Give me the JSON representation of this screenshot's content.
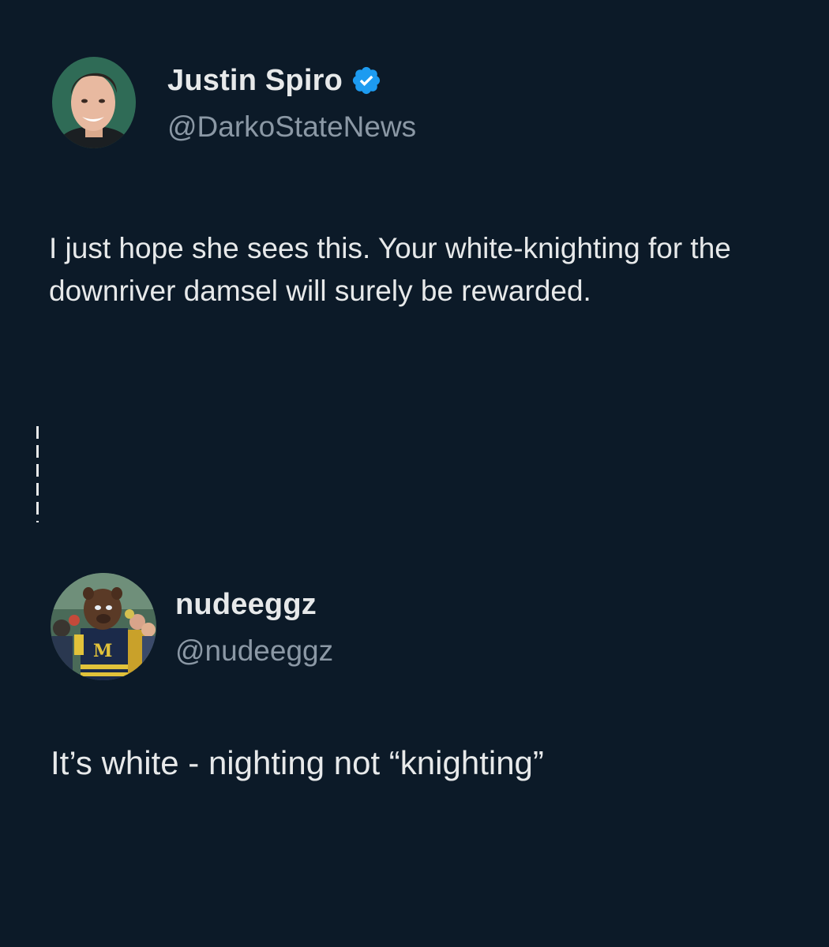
{
  "tweets": [
    {
      "display_name": "Justin Spiro",
      "handle": "@DarkoStateNews",
      "verified": true,
      "text": "I just hope she sees this. Your white-knighting for the downriver damsel will surely be rewarded."
    },
    {
      "display_name": "nudeeggz",
      "handle": "@nudeeggz",
      "verified": false,
      "text": "It’s white - nighting not “knighting”",
      "avatar_logo_letter": "M"
    }
  ],
  "colors": {
    "background": "#0c1a28",
    "primary_text": "#e7e9ea",
    "secondary_text": "#8b98a5",
    "verified_blue": "#1d9bf0"
  }
}
